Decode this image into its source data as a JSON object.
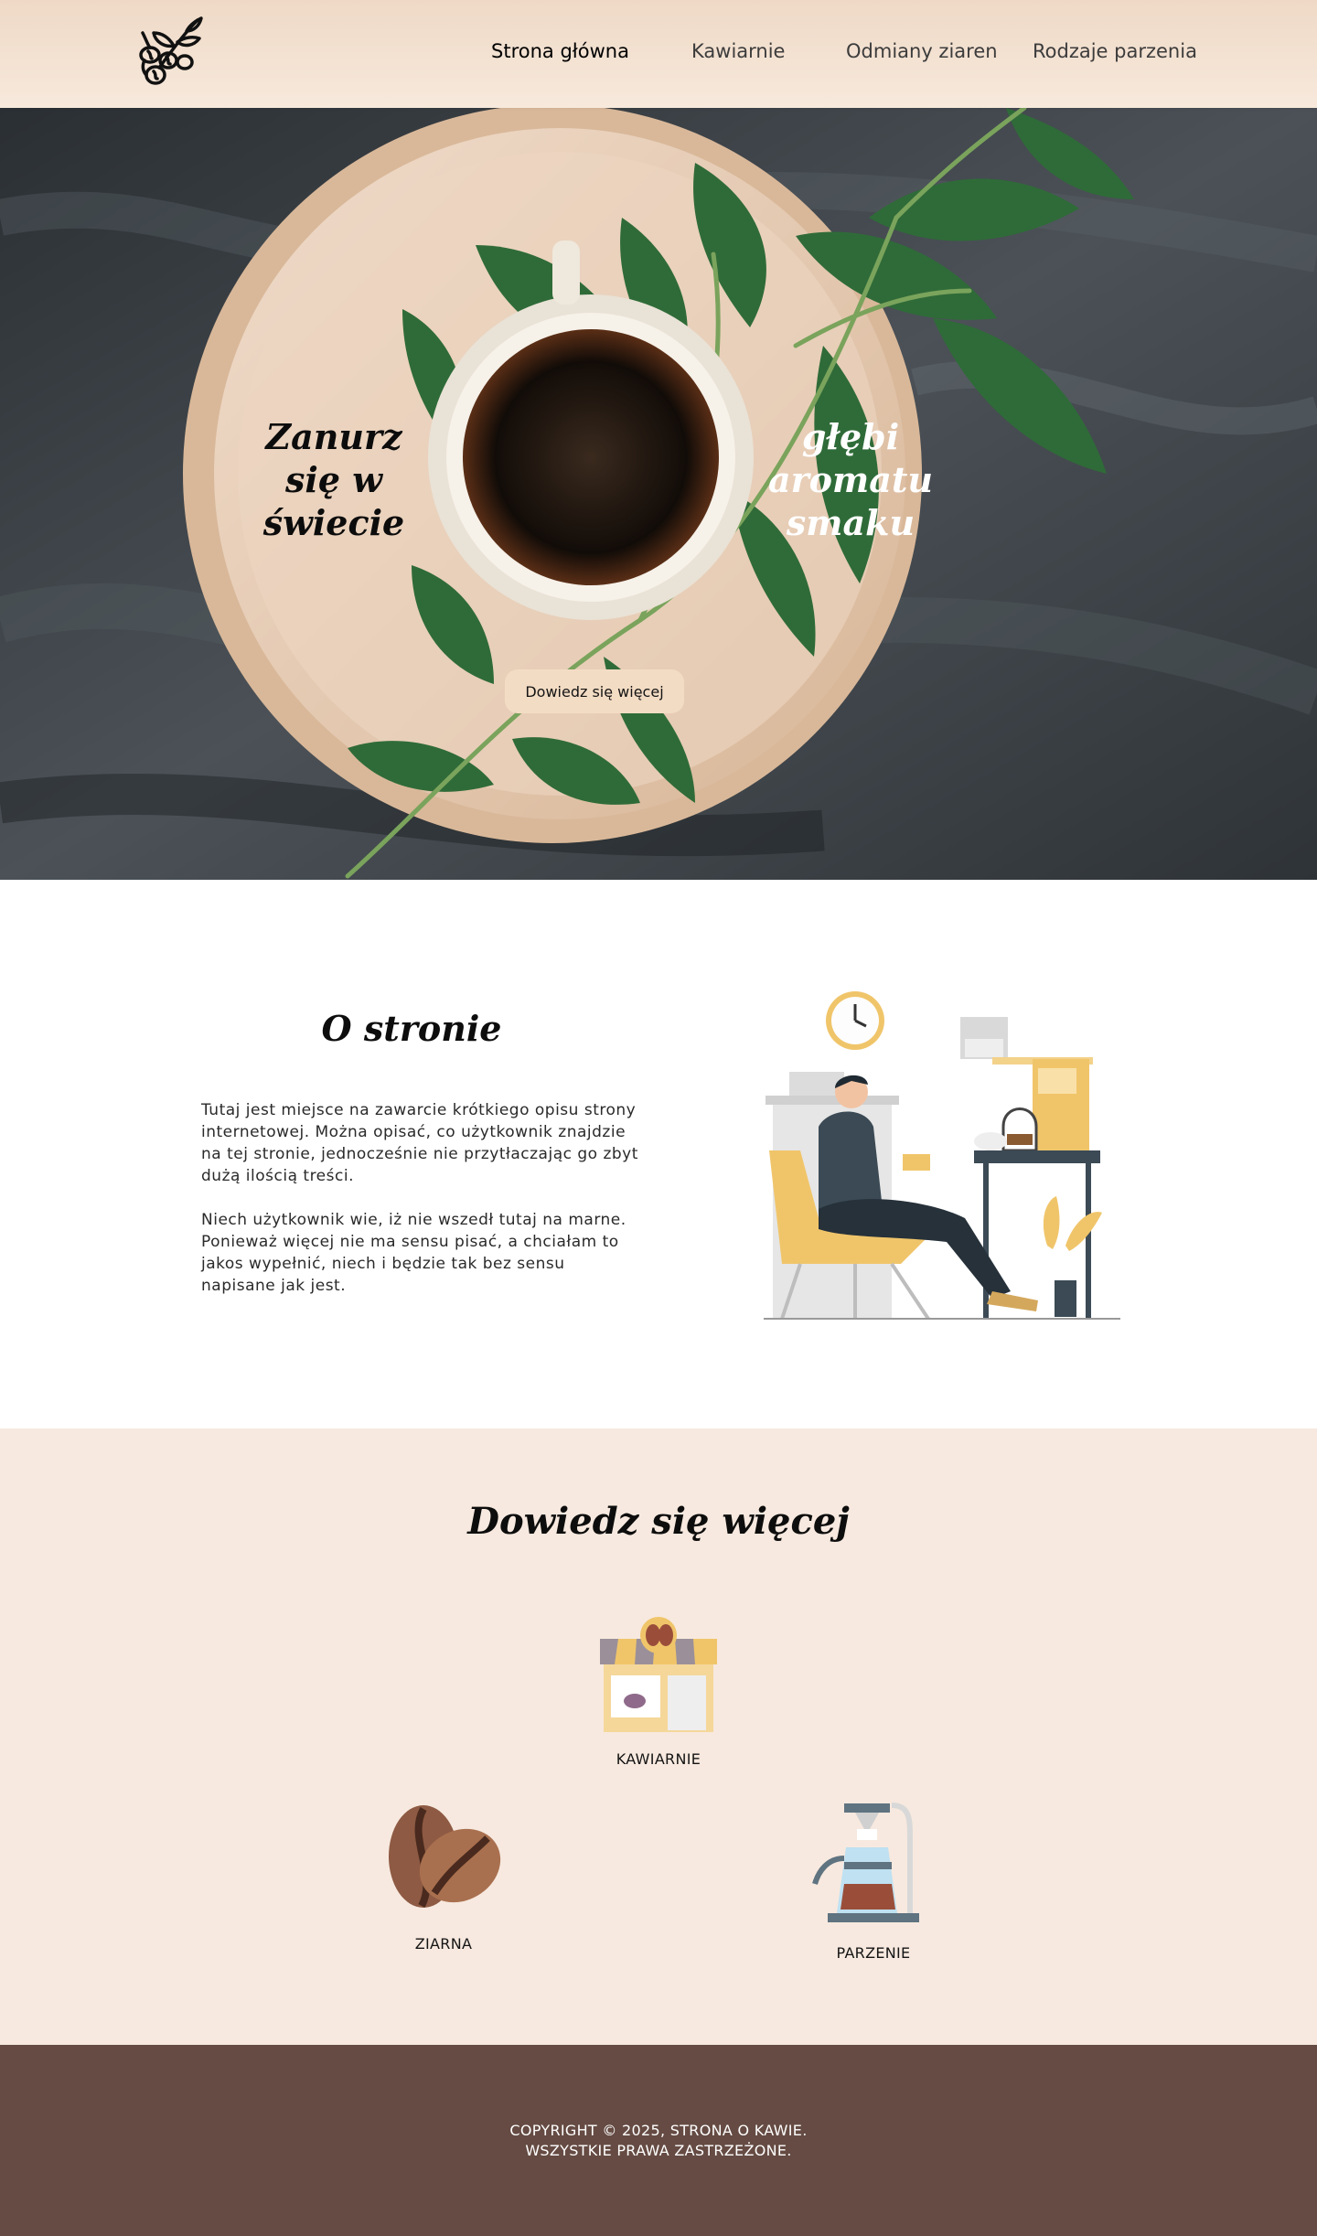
{
  "nav": {
    "items": [
      {
        "label": "Strona główna",
        "active": true
      },
      {
        "label": "Kawiarnie",
        "active": false
      },
      {
        "label": "Odmiany ziaren",
        "active": false
      },
      {
        "label": "Rodzaje parzenia",
        "active": false
      }
    ],
    "logo_icon": "coffee-branch-icon"
  },
  "hero": {
    "left_text": "Zanurz\nsię w\nświecie",
    "right_text": "głębi\naromatu\nsmaku",
    "button_label": "Dowiedz się więcej"
  },
  "about": {
    "title": "O stronie",
    "paragraph1": "Tutaj jest miejsce na zawarcie krótkiego opisu strony internetowej. Można opisać, co użytkownik znajdzie na tej stronie, jednocześnie nie przytłaczając go zbyt dużą ilością treści.",
    "paragraph2": "Niech użytkownik wie, iż nie wszedł tutaj na marne. Ponieważ więcej nie ma sensu pisać, a chciałam to jakos wypełnić, niech i będzie tak bez sensu napisane jak jest."
  },
  "more": {
    "title": "Dowiedz się więcej",
    "cards": [
      {
        "label": "KAWIARNIE",
        "icon": "cafe-shop-icon"
      },
      {
        "label": "ZIARNA",
        "icon": "coffee-beans-icon"
      },
      {
        "label": "PARZENIE",
        "icon": "pour-over-icon"
      }
    ]
  },
  "footer": {
    "line1": "COPYRIGHT © 2025, STRONA O KAWIE.",
    "line2": "WSZYSTKIE PRAWA ZASTRZEŻONE."
  },
  "colors": {
    "header_bg": "#efd9c6",
    "button_bg": "#f3dcc4",
    "section_bg": "#f7e9df",
    "footer_bg": "#654b43"
  }
}
